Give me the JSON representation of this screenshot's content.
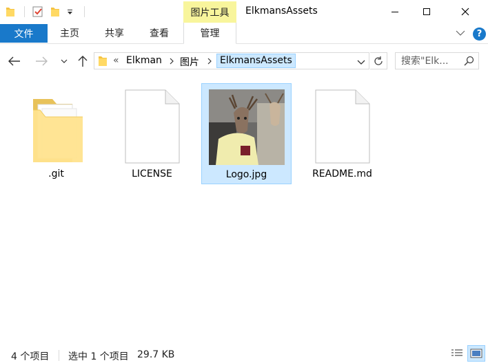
{
  "window": {
    "title": "ElkmansAssets",
    "context_tab_group": "图片工具"
  },
  "ribbon": {
    "tabs": [
      {
        "label": "文件"
      },
      {
        "label": "主页"
      },
      {
        "label": "共享"
      },
      {
        "label": "查看"
      },
      {
        "label": "管理"
      }
    ]
  },
  "address": {
    "overflow": "«",
    "crumbs": [
      "Elkman",
      "图片",
      "ElkmansAssets"
    ]
  },
  "search": {
    "placeholder": "搜索\"Elk..."
  },
  "items": [
    {
      "name": ".git",
      "type": "folder",
      "selected": false
    },
    {
      "name": "LICENSE",
      "type": "file",
      "selected": false
    },
    {
      "name": "Logo.jpg",
      "type": "image",
      "selected": true
    },
    {
      "name": "README.md",
      "type": "file",
      "selected": false
    }
  ],
  "status": {
    "item_count": "4 个项目",
    "selection": "选中 1 个项目",
    "size": "29.7 KB"
  },
  "colors": {
    "accent": "#1979ca",
    "selection_bg": "#cce8ff",
    "selection_border": "#99d1ff",
    "context_tab": "#f8f59c"
  }
}
